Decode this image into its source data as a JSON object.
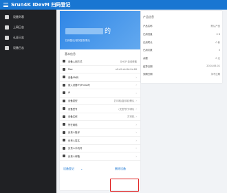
{
  "app": {
    "title": "Srun4K IDevM 扫码登记"
  },
  "sidebar": {
    "items": [
      {
        "label": "设备列表",
        "icon": "device-icon"
      },
      {
        "label": "上网日志",
        "icon": "log-icon"
      },
      {
        "label": "认证日志",
        "icon": "auth-icon"
      },
      {
        "label": "设备日志",
        "icon": "device-log-icon"
      }
    ]
  },
  "device": {
    "name_suffix": "的",
    "subtitle": "扫码登记/首次登录/默认"
  },
  "basic_info": {
    "title": "基本信息",
    "rows": [
      {
        "label": "设备入网方式",
        "value": "DHCP 自动获取",
        "icon": "network-icon"
      },
      {
        "label": "Mac",
        "value": "a2:e2:eb:6d:0e:66",
        "icon": "mac-icon"
      },
      {
        "label": "设备SN码",
        "value": "",
        "icon": "sn-icon"
      },
      {
        "label": "嵌入设备IP(IPv4&IP)",
        "value": "",
        "icon": "ip-icon"
      },
      {
        "label": "IP",
        "value": "",
        "icon": "ip-alt-icon"
      },
      {
        "label": "设备类型",
        "value": "打印机/复印机/默认",
        "icon": "type-icon"
      },
      {
        "label": "设备型号",
        "value": "(无型号打印机)",
        "icon": "model-icon"
      },
      {
        "label": "设备名称",
        "value": "打印机",
        "icon": "name-icon"
      },
      {
        "label": "所在网络",
        "value": "",
        "icon": "net-icon"
      },
      {
        "label": "负责人账号",
        "value": "",
        "icon": "account-icon"
      },
      {
        "label": "负责人姓名",
        "value": "",
        "icon": "owner-icon"
      },
      {
        "label": "负责人手机号",
        "value": "",
        "icon": "phone-icon"
      },
      {
        "label": "负责人邮箱",
        "value": "",
        "icon": "email-icon"
      }
    ]
  },
  "actions": {
    "left": "设备登记",
    "right": "删除设备"
  },
  "product": {
    "title": "产品信息",
    "rows": [
      {
        "label": "产品名称",
        "value": "默认产品"
      },
      {
        "label": "已用流量",
        "value": "0 B"
      },
      {
        "label": "已用时长",
        "value": "0 秒"
      },
      {
        "label": "已用次数",
        "value": "0"
      },
      {
        "label": "余额",
        "value": "0 元"
      },
      {
        "label": "结算日期",
        "value": "2024-06-01"
      },
      {
        "label": "到期日期",
        "value": "永不过期"
      }
    ]
  }
}
